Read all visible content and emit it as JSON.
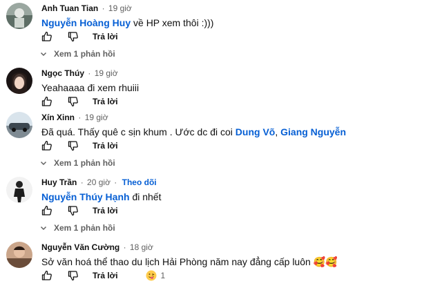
{
  "comments": [
    {
      "author": "Anh Tuan Tian",
      "time": "19 giờ",
      "mention": "Nguyễn Hoàng Huy",
      "text": " về HP xem thôi :)))",
      "reply_label": "Trả lời",
      "view_replies": "Xem 1 phản hồi"
    },
    {
      "author": "Ngọc Thúy",
      "time": "19 giờ",
      "text": "Yeahaaaa đi xem rhuiii",
      "reply_label": "Trả lời"
    },
    {
      "author": "Xín Xinn",
      "time": "19 giờ",
      "text": "Đã quá. Thấy quê c sịn khum . Ước dc đi coi ",
      "mention1": "Dung Võ",
      "separator": ", ",
      "mention2": "Giang Nguyễn",
      "reply_label": "Trả lời",
      "view_replies": "Xem 1 phản hồi"
    },
    {
      "author": "Huy Trần",
      "time": "20 giờ",
      "follow": "Theo dõi",
      "mention": "Nguyễn Thúy Hạnh",
      "text": " đi nhết",
      "reply_label": "Trả lời",
      "view_replies": "Xem 1 phản hồi"
    },
    {
      "author": "Nguyễn Văn Cường",
      "time": "18 giờ",
      "text": "Sở văn hoá thể thao du lịch Hải Phòng năm nay đẳng cấp luôn 🥰🥰",
      "reply_label": "Trả lời",
      "reaction_count": "1"
    }
  ],
  "icons": {
    "like": "thumbs-up-icon",
    "dislike": "thumbs-down-icon",
    "expand": "chevron-down-icon",
    "reaction": "face-with-tongue-emoji"
  },
  "colors": {
    "link": "#065fd4",
    "secondary": "#606060"
  }
}
